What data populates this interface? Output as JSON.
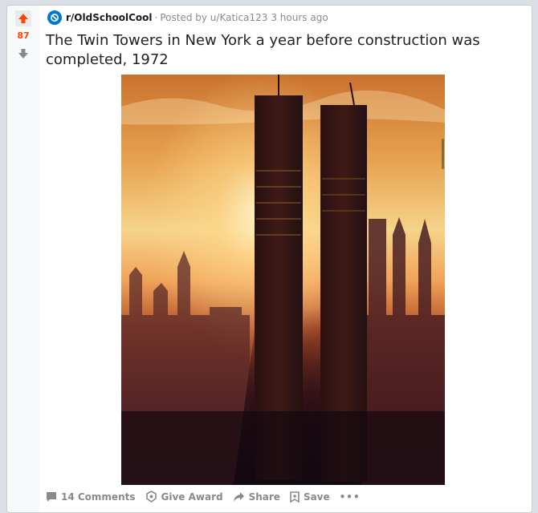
{
  "vote": {
    "score": "87"
  },
  "post": {
    "subreddit": "r/OldSchoolCool",
    "separator": "·",
    "posted_by": "Posted by u/Katica123",
    "time": "3 hours ago",
    "title": "The Twin Towers in New York a year before construction was completed, 1972"
  },
  "actions": {
    "comments": "14 Comments",
    "award": "Give Award",
    "share": "Share",
    "save": "Save",
    "more": "•••"
  },
  "colors": {
    "upvote": "#ff4500",
    "subreddit_icon": "#0079d3",
    "meta": "#878a8c"
  },
  "icons": [
    "upvote-arrow",
    "downvote-arrow",
    "subreddit-icon",
    "comment-icon",
    "award-icon",
    "share-icon",
    "save-icon"
  ]
}
